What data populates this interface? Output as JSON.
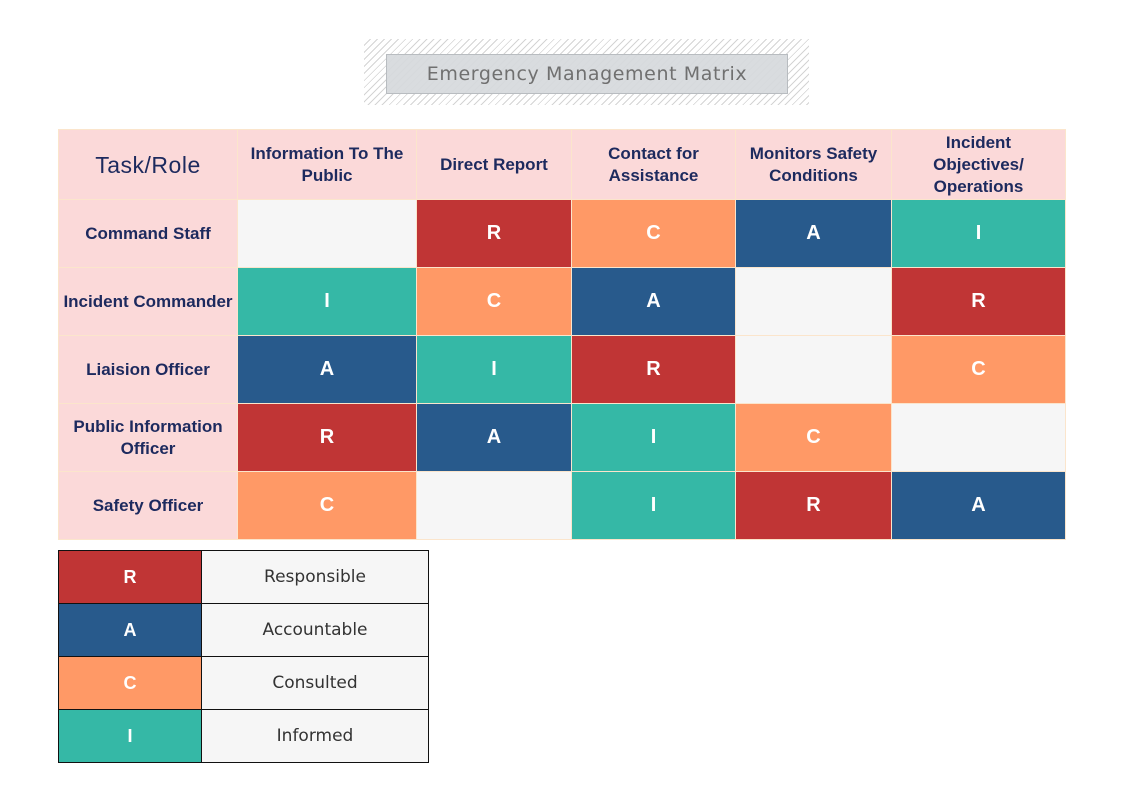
{
  "title": "Emergency Management Matrix",
  "matrix": {
    "corner_label": "Task/Role",
    "columns": [
      "Information To The Public",
      "Direct Report",
      "Contact for Assistance",
      "Monitors Safety Conditions",
      "Incident Objectives/ Operations"
    ],
    "rows": [
      {
        "role": "Command Staff",
        "cells": [
          "",
          "R",
          "C",
          "A",
          "I"
        ]
      },
      {
        "role": "Incident Commander",
        "cells": [
          "I",
          "C",
          "A",
          "",
          "R"
        ]
      },
      {
        "role": "Liaision Officer",
        "cells": [
          "A",
          "I",
          "R",
          "",
          "C"
        ]
      },
      {
        "role": "Public Information Officer",
        "cells": [
          "R",
          "A",
          "I",
          "C",
          ""
        ]
      },
      {
        "role": "Safety Officer",
        "cells": [
          "C",
          "",
          "I",
          "R",
          "A"
        ]
      }
    ]
  },
  "legend": [
    {
      "code": "R",
      "label": "Responsible",
      "color": "#c03535"
    },
    {
      "code": "A",
      "label": "Accountable",
      "color": "#285a8c"
    },
    {
      "code": "C",
      "label": "Consulted",
      "color": "#ff9966"
    },
    {
      "code": "I",
      "label": "Informed",
      "color": "#35b8a6"
    }
  ],
  "colors": {
    "header_bg": "#fbd9d9",
    "header_text": "#1d2a5e",
    "empty_cell": "#f6f6f6",
    "grid_line": "#fbe5cc"
  }
}
